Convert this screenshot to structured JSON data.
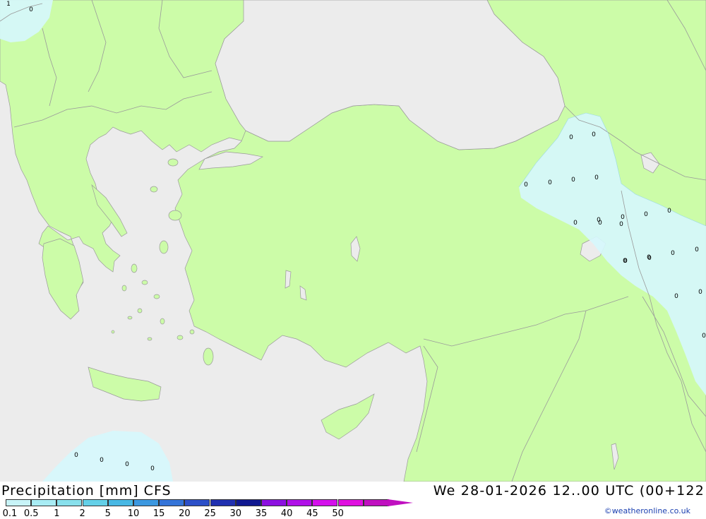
{
  "map": {
    "colors": {
      "sea": "#ececec",
      "land": "#ccfca8",
      "precip_light": "#d6f7fc",
      "border": "#9a9a9a"
    },
    "markers": {
      "top_left": [
        "1",
        "0"
      ],
      "east": [
        "0",
        "0",
        "0",
        "0",
        "0",
        "0",
        "0",
        "0",
        "0",
        "0",
        "0",
        "0",
        "0",
        "0",
        "0",
        "0",
        "0",
        "0",
        "0",
        "0",
        "0",
        "0"
      ],
      "south": [
        "0",
        "0",
        "0",
        "0"
      ]
    }
  },
  "footer": {
    "title": "Precipitation [mm] CFS",
    "datetime": "We 28-01-2026 12..00 UTC (00+122",
    "credit": "©weatheronline.co.uk"
  },
  "legend": {
    "labels": [
      "0.1",
      "0.5",
      "1",
      "2",
      "5",
      "10",
      "15",
      "20",
      "25",
      "30",
      "35",
      "40",
      "45",
      "50"
    ],
    "colors": [
      "#c8f4f8",
      "#a8ecf4",
      "#88e0ec",
      "#64d0e8",
      "#48b8e4",
      "#3c98e0",
      "#3474d8",
      "#2c50c8",
      "#2030b0",
      "#101890",
      "#8c10e0",
      "#b010e8",
      "#d410ec",
      "#e010e0",
      "#c010c0"
    ]
  }
}
